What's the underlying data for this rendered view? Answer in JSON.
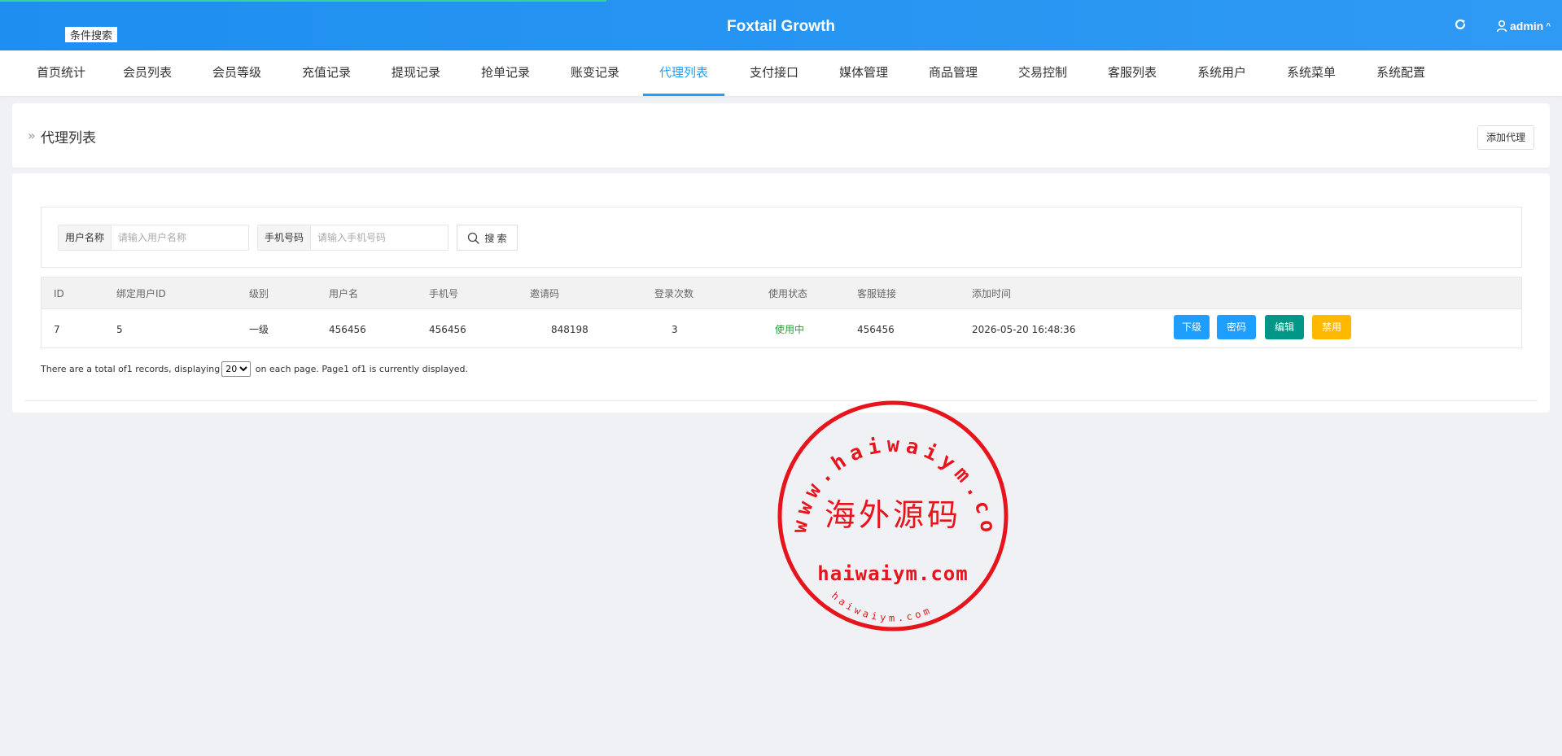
{
  "header": {
    "title": "Foxtail Growth",
    "refresh_icon": "refresh-icon",
    "user_icon": "user-icon",
    "user_name": "admin",
    "colors": {
      "bar": "#1e8ff0",
      "loading": "#37d39a"
    }
  },
  "nav": {
    "tabs": [
      {
        "label": "首页统计"
      },
      {
        "label": "会员列表"
      },
      {
        "label": "会员等级"
      },
      {
        "label": "充值记录"
      },
      {
        "label": "提现记录"
      },
      {
        "label": "抢单记录"
      },
      {
        "label": "账变记录"
      },
      {
        "label": "代理列表",
        "active": true
      },
      {
        "label": "支付接口"
      },
      {
        "label": "媒体管理"
      },
      {
        "label": "商品管理"
      },
      {
        "label": "交易控制"
      },
      {
        "label": "客服列表"
      },
      {
        "label": "系统用户"
      },
      {
        "label": "系统菜单"
      },
      {
        "label": "系统配置"
      }
    ],
    "active_color": "#1e9fff"
  },
  "page": {
    "title": "代理列表",
    "add_button": "添加代理"
  },
  "search": {
    "legend": "条件搜索",
    "username_label": "用户名称",
    "username_placeholder": "请输入用户名称",
    "username_value": "",
    "phone_label": "手机号码",
    "phone_placeholder": "请输入手机号码",
    "phone_value": "",
    "button": "搜 索"
  },
  "table": {
    "headers": [
      "ID",
      "绑定用户ID",
      "级别",
      "用户名",
      "手机号",
      "邀请码",
      "登录次数",
      "使用状态",
      "客服链接",
      "添加时间"
    ],
    "rows": [
      {
        "id": "7",
        "bind_user_id": "5",
        "level": "一级",
        "username": "456456",
        "phone": "456456",
        "invite_code": "848198",
        "login_count": "3",
        "status": "使用中",
        "service_link": "456456",
        "added_time": "2026-05-20 16:48:36",
        "actions": [
          {
            "label": "下级",
            "color": "#1e9fff"
          },
          {
            "label": "密码",
            "color": "#1e9fff"
          },
          {
            "label": "编辑",
            "color": "#009688"
          },
          {
            "label": "禁用",
            "color": "#ffb800"
          }
        ]
      }
    ],
    "status_color": "#2e9e3a"
  },
  "pagination": {
    "text_before": "There are a total of1 records, displaying",
    "page_size": "20",
    "page_size_options": [
      "20"
    ],
    "text_after": " on each page. Page1 of1 is currently displayed."
  },
  "watermark": {
    "center_text": "海外源码",
    "ring_text": "www.haiwaiym.com",
    "domain_text": "haiwaiym.com",
    "small_text": "haiwaiym.com",
    "color": "#e8141c"
  }
}
